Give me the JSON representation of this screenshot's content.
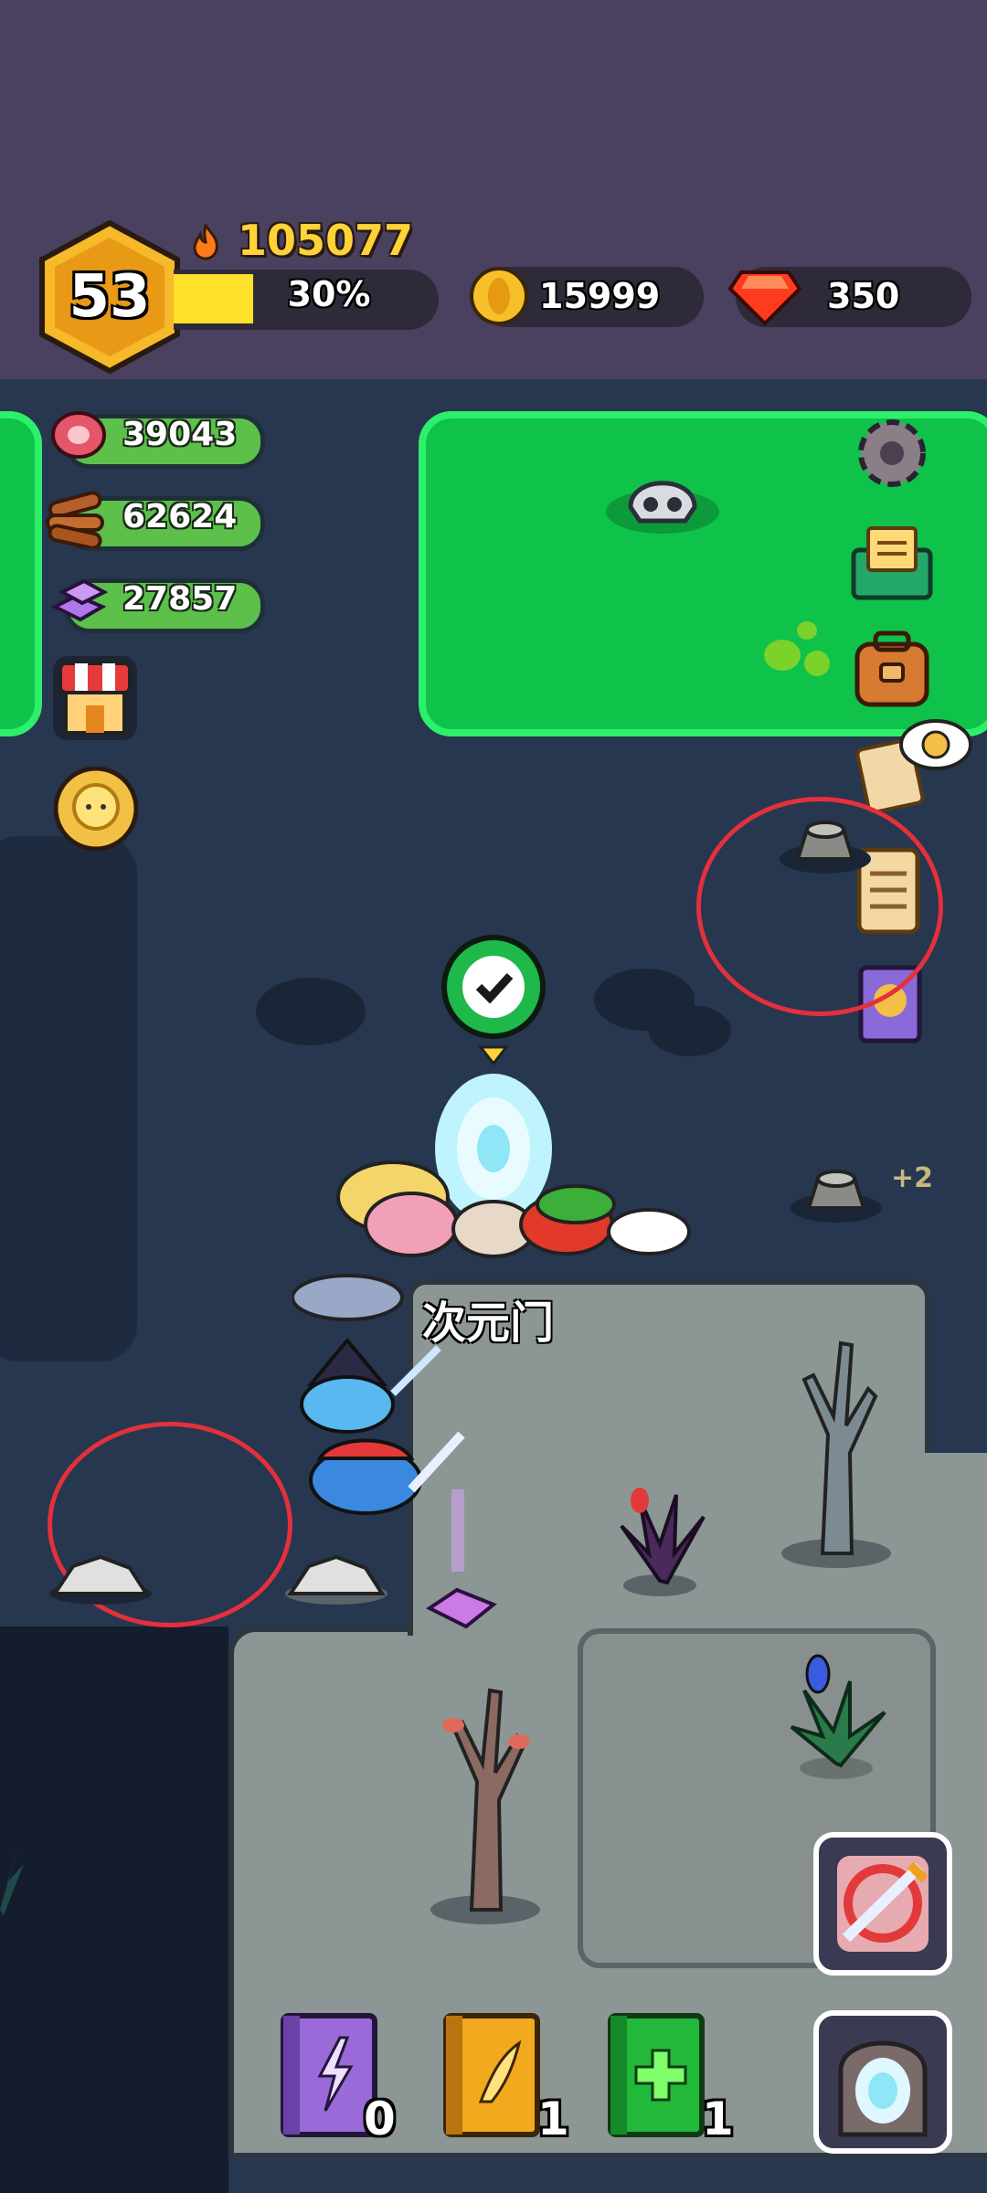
{
  "player": {
    "level": "53",
    "power": "105077",
    "xp_percent_label": "30%",
    "xp_fraction": 0.3
  },
  "currencies": {
    "gold": "15999",
    "gems": "350"
  },
  "resources": [
    {
      "name": "meat",
      "value": "39043"
    },
    {
      "name": "wood",
      "value": "62624"
    },
    {
      "name": "crystal",
      "value": "27857"
    }
  ],
  "map": {
    "portal_label": "次元门",
    "bonus_label": "+2"
  },
  "books": [
    {
      "name": "lightning-book",
      "count": "0"
    },
    {
      "name": "wing-book",
      "count": "1"
    },
    {
      "name": "heal-book",
      "count": "1"
    }
  ],
  "colors": {
    "xp_bar": "#ffe02a",
    "green_zone": "#0fc24a",
    "annotation": "#e4303c"
  }
}
